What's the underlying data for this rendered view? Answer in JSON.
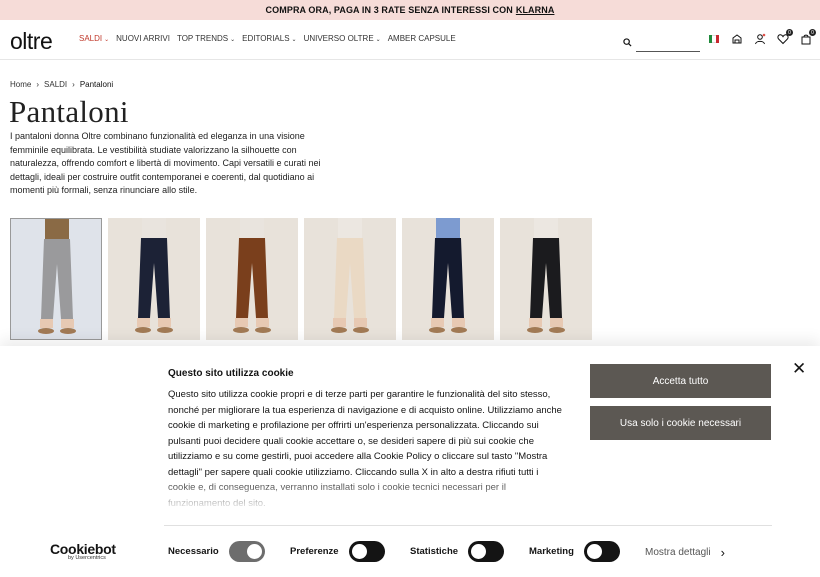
{
  "promo": {
    "text": "COMPRA ORA, PAGA IN 3 RATE SENZA INTERESSI CON",
    "link": "KLARNA"
  },
  "header": {
    "logo": "oltre",
    "nav": [
      {
        "label": "SALDI",
        "dropdown": true,
        "active": true
      },
      {
        "label": "NUOVI ARRIVI",
        "dropdown": false
      },
      {
        "label": "TOP TRENDS",
        "dropdown": true
      },
      {
        "label": "EDITORIALS",
        "dropdown": true
      },
      {
        "label": "UNIVERSO OLTRE",
        "dropdown": true
      },
      {
        "label": "AMBER CAPSULE",
        "dropdown": false
      }
    ],
    "cart_count": "0",
    "wishlist_count": "0",
    "icons": [
      "search-icon",
      "italy-flag-icon",
      "store-locator-icon",
      "account-icon",
      "wishlist-icon",
      "cart-icon"
    ]
  },
  "breadcrumb": [
    "Home",
    "SALDI",
    "Pantaloni"
  ],
  "page": {
    "title": "Pantaloni",
    "description": "I pantaloni donna Oltre combinano funzionalità ed eleganza in una visione femminile equilibrata. Le vestibilità studiate valorizzano la silhouette con naturalezza, offrendo comfort e libertà di movimento. Capi versatili e curati nei dettagli, ideali per costruire outfit contemporanei e coerenti, dal quotidiano ai momenti più formali, senza rinunciare allo stile."
  },
  "thumbnails": [
    {
      "bg": "#dfe3ea",
      "pants": "#9a9a9c",
      "top": "#8a6a45",
      "selected": true
    },
    {
      "bg": "#e8e2da",
      "pants": "#1c2236",
      "top": "#e9e4de",
      "selected": false
    },
    {
      "bg": "#e8e2da",
      "pants": "#7a3f1c",
      "top": "#e9e4de",
      "selected": false
    },
    {
      "bg": "#e8e2da",
      "pants": "#ead9c4",
      "top": "#ece7e1",
      "selected": false
    },
    {
      "bg": "#e8e2da",
      "pants": "#141a2e",
      "top": "#7d9bd0",
      "selected": false
    },
    {
      "bg": "#e8e2da",
      "pants": "#1b1b1e",
      "top": "#ece7e1",
      "selected": false
    }
  ],
  "cookie": {
    "title": "Questo sito utilizza cookie",
    "body": "Questo sito utilizza cookie propri e di terze parti per garantire le funzionalità del sito stesso, nonché per migliorare la tua esperienza di navigazione e di acquisto online. Utilizziamo anche cookie di marketing e profilazione per offrirti un'esperienza personalizzata. Cliccando sui pulsanti puoi decidere quali cookie accettare o, se desideri sapere di più sui cookie che utilizziamo e su come gestirli, puoi accedere alla Cookie Policy o cliccare sul tasto \"Mostra dettagli\" per sapere quali cookie utilizziamo. Cliccando sulla X in alto a destra rifiuti tutti i cookie e, di conseguenza, verranno installati solo i cookie tecnici necessari per il funzionamento del sito.",
    "accept_all": "Accetta tutto",
    "only_necessary": "Usa solo i cookie necessari",
    "close": "✕",
    "brand": "Cookiebot",
    "brand_sub": "by Usercentrics",
    "toggles": [
      {
        "label": "Necessario",
        "on": true
      },
      {
        "label": "Preferenze",
        "on": false
      },
      {
        "label": "Statistiche",
        "on": false
      },
      {
        "label": "Marketing",
        "on": false
      }
    ],
    "details": "Mostra dettagli"
  },
  "colors": {
    "promo_bg": "#f6dcd8",
    "active_nav": "#c0392b",
    "button_bg": "#5c5853"
  }
}
